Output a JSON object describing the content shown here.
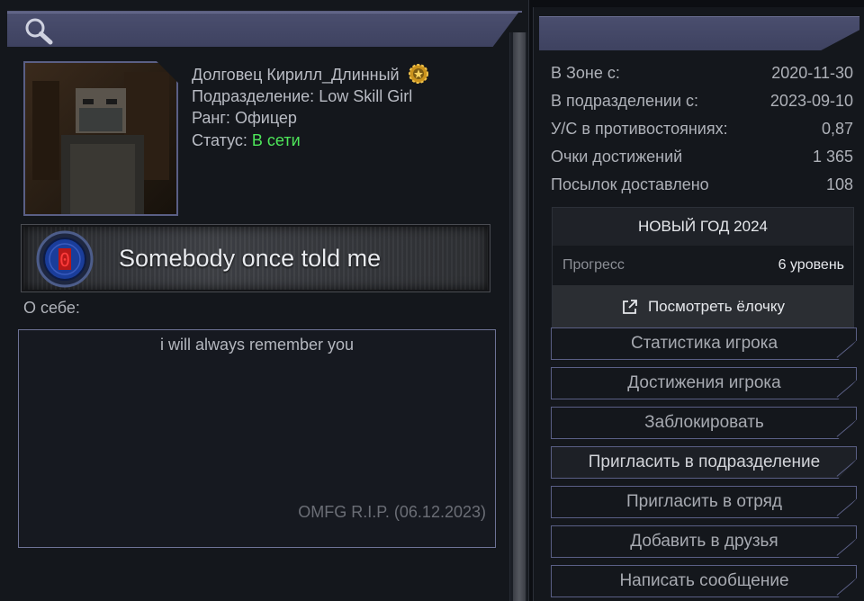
{
  "profile": {
    "name": "Долговец Кирилл_Длинный",
    "unit_label": "Подразделение:",
    "unit_value": "Low Skill Girl",
    "rank_label": "Ранг:",
    "rank_value": "Офицер",
    "status_label": "Статус:",
    "status_value": "В сети",
    "status_color": "#4ee65a"
  },
  "banner": {
    "text": "Somebody once told me",
    "emblem_digit": "0"
  },
  "about": {
    "label": "О себе:",
    "text": "i will always remember you",
    "signature": "OMFG  R.I.P. (06.12.2023)"
  },
  "stats": [
    {
      "label": "В Зоне с:",
      "value": "2020-11-30"
    },
    {
      "label": "В подразделении с:",
      "value": "2023-09-10"
    },
    {
      "label": "У/С в противостояниях:",
      "value": "0,87"
    },
    {
      "label": "Очки достижений",
      "value": "1 365"
    },
    {
      "label": "Посылок доставлено",
      "value": "108"
    }
  ],
  "event": {
    "title": "НОВЫЙ ГОД 2024",
    "progress_label": "Прогресс",
    "progress_value": "6 уровень",
    "button_label": "Посмотреть ёлочку"
  },
  "actions": [
    "Статистика игрока",
    "Достижения игрока",
    "Заблокировать",
    "Пригласить в подразделение",
    "Пригласить в отряд",
    "Добавить в друзья",
    "Написать сообщение"
  ],
  "colors": {
    "accent": "#4a4e6e",
    "online": "#4ee65a",
    "background": "#14171c"
  }
}
